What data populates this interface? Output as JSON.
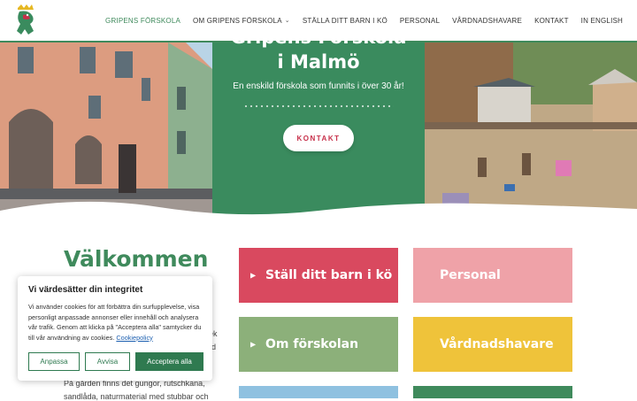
{
  "header": {
    "nav": [
      {
        "label": "GRIPENS FÖRSKOLA",
        "active": true
      },
      {
        "label": "OM GRIPENS FÖRSKOLA",
        "dropdown": true
      },
      {
        "label": "STÄLLA DITT BARN I KÖ"
      },
      {
        "label": "PERSONAL"
      },
      {
        "label": "VÅRDNADSHAVARE"
      },
      {
        "label": "KONTAKT"
      },
      {
        "label": "IN ENGLISH"
      }
    ]
  },
  "hero": {
    "title_line1": "Gripens Förskola",
    "title_line2": "i Malmö",
    "subtitle": "En enskild förskola som funnits i över 30 år!",
    "button_label": "KONTAKT"
  },
  "main": {
    "welcome_title": "Välkommen",
    "text_fragment_1": "ek",
    "text_fragment_2": "rd",
    "text_line_3": "På gården finns det gungor, rutschkana,",
    "text_line_4": "sandlåda, naturmaterial med stubbar och"
  },
  "tiles": [
    {
      "label": "Ställ ditt barn i kö",
      "arrow": true
    },
    {
      "label": "Personal",
      "arrow": false
    },
    {
      "label": "Om förskolan",
      "arrow": true
    },
    {
      "label": "Vårdnadshavare",
      "arrow": false
    }
  ],
  "cookie": {
    "title": "Vi värdesätter din integritet",
    "text": "Vi använder cookies för att förbättra din surfupplevelse, visa personligt anpassade annonser eller innehåll och analysera vår trafik. Genom att klicka på \"Acceptera alla\" samtycker du till vår användning av cookies.",
    "policy_link": "Cookiepolicy",
    "btn_customize": "Anpassa",
    "btn_reject": "Avvisa",
    "btn_accept": "Acceptera alla"
  },
  "colors": {
    "brand_green": "#3f8a5c",
    "accent_red": "#c7304a"
  }
}
